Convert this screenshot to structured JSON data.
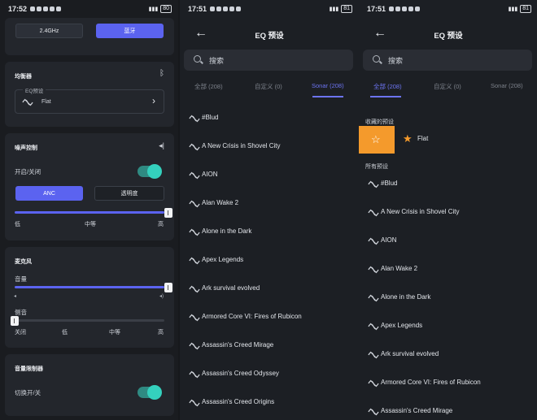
{
  "screens": [
    {
      "status": {
        "time": "17:52",
        "battery": "80"
      },
      "band": {
        "option_a": "2.4GHz",
        "option_b": "蓝牙",
        "selected": "蓝牙"
      },
      "equalizer": {
        "title": "均衡器",
        "box_label": "EQ预设",
        "value": "Flat"
      },
      "noise": {
        "title": "噪声控制",
        "toggle_label": "开启/关闭",
        "mode_a": "ANC",
        "mode_b": "透明度",
        "selected": "ANC",
        "level_labels": [
          "低",
          "中等",
          "高"
        ],
        "level": 1.0
      },
      "mic": {
        "title": "麦克风",
        "volume_label": "音量",
        "volume_level": 1.0,
        "sidetone_label": "侧音",
        "sidetone_level": 0.0,
        "sidetone_labels": [
          "关闭",
          "低",
          "中等",
          "高"
        ]
      },
      "limiter": {
        "title": "音量限制器",
        "toggle_label": "切换开/关"
      }
    },
    {
      "status": {
        "time": "17:51",
        "battery": "81"
      },
      "title": "EQ 预设",
      "search_placeholder": "搜索",
      "tabs": [
        "全部 (208)",
        "自定义 (0)",
        "Sonar (208)"
      ],
      "active_tab": 2,
      "presets": [
        "#Blud",
        "A New Crisis in Shovel City",
        "AION",
        "Alan Wake 2",
        "Alone in the Dark",
        "Apex Legends",
        "Ark survival evolved",
        "Armored Core VI: Fires of Rubicon",
        "Assassin's Creed Mirage",
        "Assassin's Creed Odyssey",
        "Assassin's Creed Origins"
      ]
    },
    {
      "status": {
        "time": "17:51",
        "battery": "81"
      },
      "title": "EQ 预设",
      "search_placeholder": "搜索",
      "tabs": [
        "全部 (208)",
        "自定义 (0)",
        "Sonar (208)"
      ],
      "active_tab": 0,
      "favorites_label": "收藏的预设",
      "favorite": "Flat",
      "all_label": "所有预设",
      "presets": [
        "#Blud",
        "A New Crisis in Shovel City",
        "AION",
        "Alan Wake 2",
        "Alone in the Dark",
        "Apex Legends",
        "Ark survival evolved",
        "Armored Core VI: Fires of Rubicon",
        "Assassin's Creed Mirage"
      ]
    }
  ],
  "colors": {
    "accent": "#5b63f0",
    "toggle": "#34d0bd",
    "favorite": "#f49a2c"
  }
}
